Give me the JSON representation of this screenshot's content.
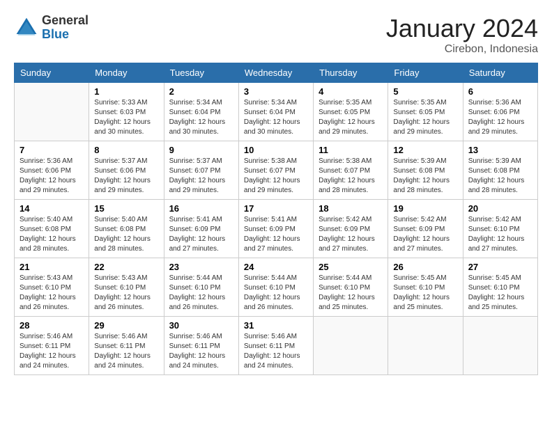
{
  "header": {
    "logo_general": "General",
    "logo_blue": "Blue",
    "month_title": "January 2024",
    "location": "Cirebon, Indonesia"
  },
  "weekdays": [
    "Sunday",
    "Monday",
    "Tuesday",
    "Wednesday",
    "Thursday",
    "Friday",
    "Saturday"
  ],
  "weeks": [
    [
      {
        "day": "",
        "sunrise": "",
        "sunset": "",
        "daylight": ""
      },
      {
        "day": "1",
        "sunrise": "Sunrise: 5:33 AM",
        "sunset": "Sunset: 6:03 PM",
        "daylight": "Daylight: 12 hours and 30 minutes."
      },
      {
        "day": "2",
        "sunrise": "Sunrise: 5:34 AM",
        "sunset": "Sunset: 6:04 PM",
        "daylight": "Daylight: 12 hours and 30 minutes."
      },
      {
        "day": "3",
        "sunrise": "Sunrise: 5:34 AM",
        "sunset": "Sunset: 6:04 PM",
        "daylight": "Daylight: 12 hours and 30 minutes."
      },
      {
        "day": "4",
        "sunrise": "Sunrise: 5:35 AM",
        "sunset": "Sunset: 6:05 PM",
        "daylight": "Daylight: 12 hours and 29 minutes."
      },
      {
        "day": "5",
        "sunrise": "Sunrise: 5:35 AM",
        "sunset": "Sunset: 6:05 PM",
        "daylight": "Daylight: 12 hours and 29 minutes."
      },
      {
        "day": "6",
        "sunrise": "Sunrise: 5:36 AM",
        "sunset": "Sunset: 6:06 PM",
        "daylight": "Daylight: 12 hours and 29 minutes."
      }
    ],
    [
      {
        "day": "7",
        "sunrise": "Sunrise: 5:36 AM",
        "sunset": "Sunset: 6:06 PM",
        "daylight": "Daylight: 12 hours and 29 minutes."
      },
      {
        "day": "8",
        "sunrise": "Sunrise: 5:37 AM",
        "sunset": "Sunset: 6:06 PM",
        "daylight": "Daylight: 12 hours and 29 minutes."
      },
      {
        "day": "9",
        "sunrise": "Sunrise: 5:37 AM",
        "sunset": "Sunset: 6:07 PM",
        "daylight": "Daylight: 12 hours and 29 minutes."
      },
      {
        "day": "10",
        "sunrise": "Sunrise: 5:38 AM",
        "sunset": "Sunset: 6:07 PM",
        "daylight": "Daylight: 12 hours and 29 minutes."
      },
      {
        "day": "11",
        "sunrise": "Sunrise: 5:38 AM",
        "sunset": "Sunset: 6:07 PM",
        "daylight": "Daylight: 12 hours and 28 minutes."
      },
      {
        "day": "12",
        "sunrise": "Sunrise: 5:39 AM",
        "sunset": "Sunset: 6:08 PM",
        "daylight": "Daylight: 12 hours and 28 minutes."
      },
      {
        "day": "13",
        "sunrise": "Sunrise: 5:39 AM",
        "sunset": "Sunset: 6:08 PM",
        "daylight": "Daylight: 12 hours and 28 minutes."
      }
    ],
    [
      {
        "day": "14",
        "sunrise": "Sunrise: 5:40 AM",
        "sunset": "Sunset: 6:08 PM",
        "daylight": "Daylight: 12 hours and 28 minutes."
      },
      {
        "day": "15",
        "sunrise": "Sunrise: 5:40 AM",
        "sunset": "Sunset: 6:08 PM",
        "daylight": "Daylight: 12 hours and 28 minutes."
      },
      {
        "day": "16",
        "sunrise": "Sunrise: 5:41 AM",
        "sunset": "Sunset: 6:09 PM",
        "daylight": "Daylight: 12 hours and 27 minutes."
      },
      {
        "day": "17",
        "sunrise": "Sunrise: 5:41 AM",
        "sunset": "Sunset: 6:09 PM",
        "daylight": "Daylight: 12 hours and 27 minutes."
      },
      {
        "day": "18",
        "sunrise": "Sunrise: 5:42 AM",
        "sunset": "Sunset: 6:09 PM",
        "daylight": "Daylight: 12 hours and 27 minutes."
      },
      {
        "day": "19",
        "sunrise": "Sunrise: 5:42 AM",
        "sunset": "Sunset: 6:09 PM",
        "daylight": "Daylight: 12 hours and 27 minutes."
      },
      {
        "day": "20",
        "sunrise": "Sunrise: 5:42 AM",
        "sunset": "Sunset: 6:10 PM",
        "daylight": "Daylight: 12 hours and 27 minutes."
      }
    ],
    [
      {
        "day": "21",
        "sunrise": "Sunrise: 5:43 AM",
        "sunset": "Sunset: 6:10 PM",
        "daylight": "Daylight: 12 hours and 26 minutes."
      },
      {
        "day": "22",
        "sunrise": "Sunrise: 5:43 AM",
        "sunset": "Sunset: 6:10 PM",
        "daylight": "Daylight: 12 hours and 26 minutes."
      },
      {
        "day": "23",
        "sunrise": "Sunrise: 5:44 AM",
        "sunset": "Sunset: 6:10 PM",
        "daylight": "Daylight: 12 hours and 26 minutes."
      },
      {
        "day": "24",
        "sunrise": "Sunrise: 5:44 AM",
        "sunset": "Sunset: 6:10 PM",
        "daylight": "Daylight: 12 hours and 26 minutes."
      },
      {
        "day": "25",
        "sunrise": "Sunrise: 5:44 AM",
        "sunset": "Sunset: 6:10 PM",
        "daylight": "Daylight: 12 hours and 25 minutes."
      },
      {
        "day": "26",
        "sunrise": "Sunrise: 5:45 AM",
        "sunset": "Sunset: 6:10 PM",
        "daylight": "Daylight: 12 hours and 25 minutes."
      },
      {
        "day": "27",
        "sunrise": "Sunrise: 5:45 AM",
        "sunset": "Sunset: 6:10 PM",
        "daylight": "Daylight: 12 hours and 25 minutes."
      }
    ],
    [
      {
        "day": "28",
        "sunrise": "Sunrise: 5:46 AM",
        "sunset": "Sunset: 6:11 PM",
        "daylight": "Daylight: 12 hours and 24 minutes."
      },
      {
        "day": "29",
        "sunrise": "Sunrise: 5:46 AM",
        "sunset": "Sunset: 6:11 PM",
        "daylight": "Daylight: 12 hours and 24 minutes."
      },
      {
        "day": "30",
        "sunrise": "Sunrise: 5:46 AM",
        "sunset": "Sunset: 6:11 PM",
        "daylight": "Daylight: 12 hours and 24 minutes."
      },
      {
        "day": "31",
        "sunrise": "Sunrise: 5:46 AM",
        "sunset": "Sunset: 6:11 PM",
        "daylight": "Daylight: 12 hours and 24 minutes."
      },
      {
        "day": "",
        "sunrise": "",
        "sunset": "",
        "daylight": ""
      },
      {
        "day": "",
        "sunrise": "",
        "sunset": "",
        "daylight": ""
      },
      {
        "day": "",
        "sunrise": "",
        "sunset": "",
        "daylight": ""
      }
    ]
  ]
}
